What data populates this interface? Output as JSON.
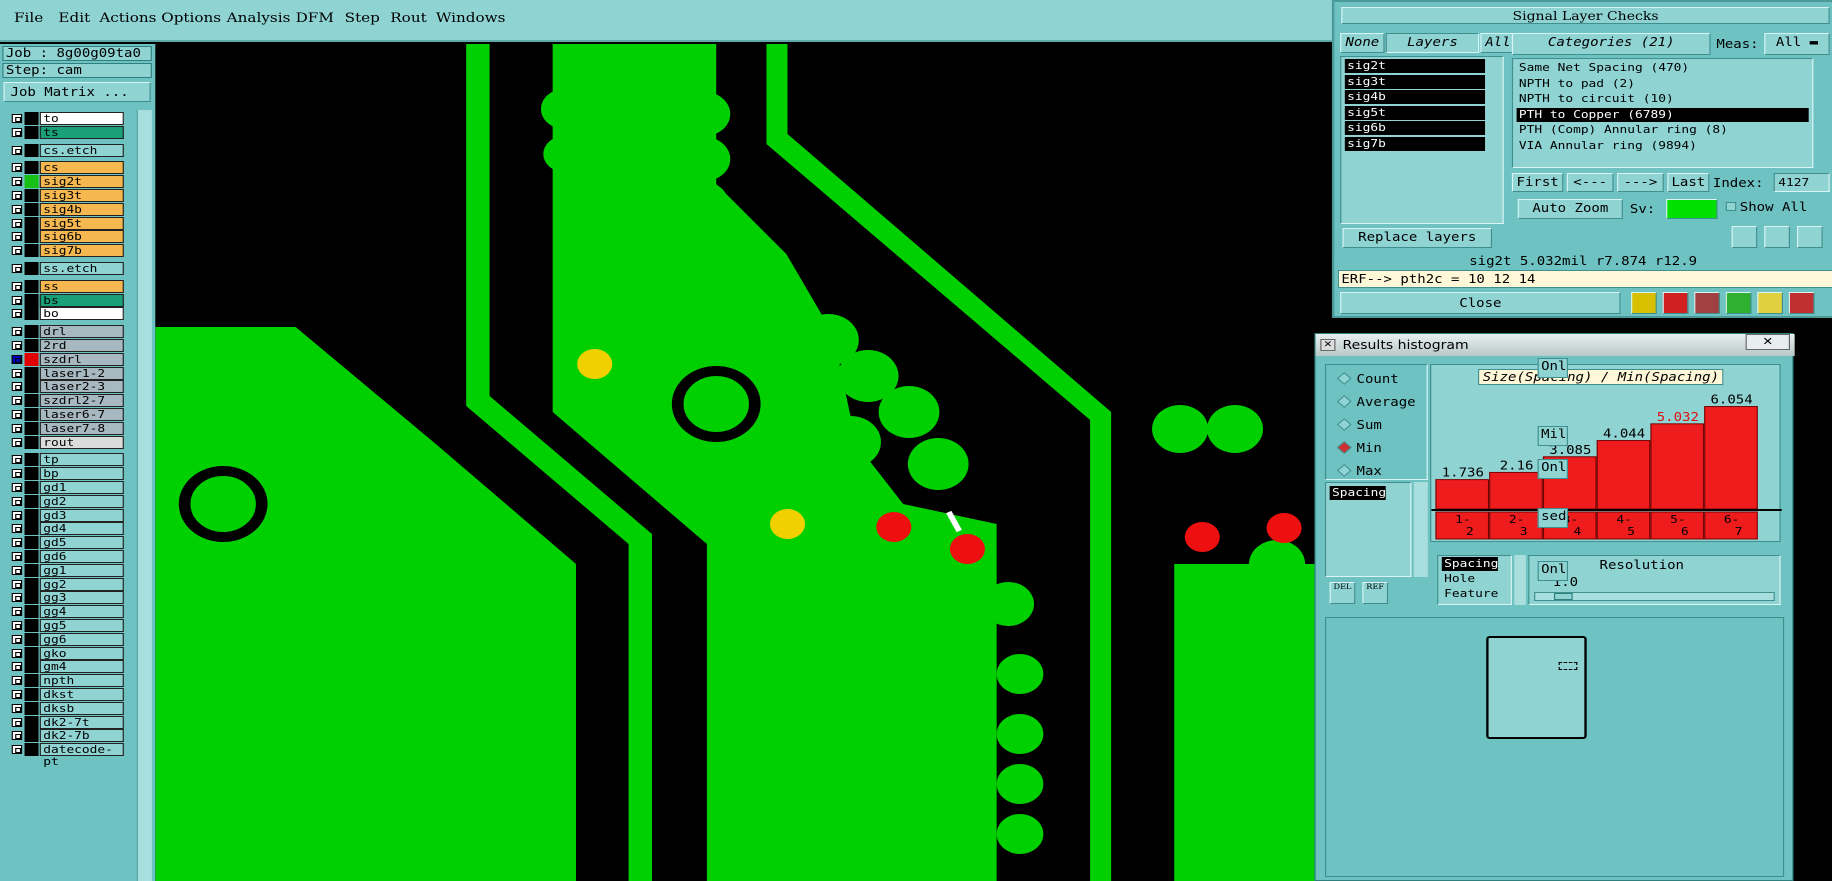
{
  "menu": [
    "File",
    "Edit",
    "Actions",
    "Options",
    "Analysis",
    "DFM",
    "Step",
    "Rout",
    "Windows"
  ],
  "job": {
    "label": "Job : 8g00g09ta0",
    "step": "Step: cam",
    "matrix_button": "Job Matrix ..."
  },
  "layers": [
    {
      "name": "to",
      "color": "#ffffff",
      "gap": false
    },
    {
      "name": "ts",
      "color": "#1aa078",
      "gap": false
    },
    {
      "name": "cs.etch",
      "color": "#8fd3d3",
      "gap": true
    },
    {
      "name": "cs",
      "color": "#f5b850",
      "gap": true
    },
    {
      "name": "sig2t",
      "color": "#f5b850",
      "gap": false,
      "swatch": "#16c016"
    },
    {
      "name": "sig3t",
      "color": "#f5b850",
      "gap": false
    },
    {
      "name": "sig4b",
      "color": "#f5b850",
      "gap": false
    },
    {
      "name": "sig5t",
      "color": "#f5b850",
      "gap": false
    },
    {
      "name": "sig6b",
      "color": "#f5b850",
      "gap": false
    },
    {
      "name": "sig7b",
      "color": "#f5b850",
      "gap": false
    },
    {
      "name": "ss.etch",
      "color": "#8fd3d3",
      "gap": true
    },
    {
      "name": "ss",
      "color": "#f5b850",
      "gap": true
    },
    {
      "name": "bs",
      "color": "#1aa078",
      "gap": false
    },
    {
      "name": "bo",
      "color": "#ffffff",
      "gap": false
    },
    {
      "name": "drl",
      "color": "#a8b8c0",
      "gap": true
    },
    {
      "name": "2rd",
      "color": "#a8b8c0",
      "gap": false
    },
    {
      "name": "szdrl",
      "color": "#a8b8c0",
      "gap": false,
      "swatch": "#e00000",
      "mark": "#0000c0"
    },
    {
      "name": "laser1-2",
      "color": "#a8b8c0",
      "gap": false
    },
    {
      "name": "laser2-3",
      "color": "#a8b8c0",
      "gap": false
    },
    {
      "name": "szdrl2-7",
      "color": "#a8b8c0",
      "gap": false
    },
    {
      "name": "laser6-7",
      "color": "#a8b8c0",
      "gap": false
    },
    {
      "name": "laser7-8",
      "color": "#a8b8c0",
      "gap": false
    },
    {
      "name": "rout",
      "color": "#dcdcdc",
      "gap": false
    },
    {
      "name": "tp",
      "color": "#8fd3d3",
      "gap": true
    },
    {
      "name": "bp",
      "color": "#8fd3d3",
      "gap": false
    },
    {
      "name": "gd1",
      "color": "#8fd3d3",
      "gap": false
    },
    {
      "name": "gd2",
      "color": "#8fd3d3",
      "gap": false
    },
    {
      "name": "gd3",
      "color": "#8fd3d3",
      "gap": false
    },
    {
      "name": "gd4",
      "color": "#8fd3d3",
      "gap": false
    },
    {
      "name": "gd5",
      "color": "#8fd3d3",
      "gap": false
    },
    {
      "name": "gd6",
      "color": "#8fd3d3",
      "gap": false
    },
    {
      "name": "gg1",
      "color": "#8fd3d3",
      "gap": false
    },
    {
      "name": "gg2",
      "color": "#8fd3d3",
      "gap": false
    },
    {
      "name": "gg3",
      "color": "#8fd3d3",
      "gap": false
    },
    {
      "name": "gg4",
      "color": "#8fd3d3",
      "gap": false
    },
    {
      "name": "gg5",
      "color": "#8fd3d3",
      "gap": false
    },
    {
      "name": "gg6",
      "color": "#8fd3d3",
      "gap": false
    },
    {
      "name": "gko",
      "color": "#8fd3d3",
      "gap": false
    },
    {
      "name": "gm4",
      "color": "#8fd3d3",
      "gap": false
    },
    {
      "name": "npth",
      "color": "#8fd3d3",
      "gap": false
    },
    {
      "name": "dkst",
      "color": "#8fd3d3",
      "gap": false
    },
    {
      "name": "dksb",
      "color": "#8fd3d3",
      "gap": false
    },
    {
      "name": "dk2-7t",
      "color": "#8fd3d3",
      "gap": false
    },
    {
      "name": "dk2-7b",
      "color": "#8fd3d3",
      "gap": false
    },
    {
      "name": "datecode-pt",
      "color": "#8fd3d3",
      "gap": false
    }
  ],
  "checks": {
    "title": "Signal Layer Checks",
    "none_button": "None",
    "layers_button": "Layers",
    "all_button": "All",
    "layer_list": [
      "sig2t",
      "sig3t",
      "sig4b",
      "sig5t",
      "sig6b",
      "sig7b"
    ],
    "categories_button": "Categories (21)",
    "meas_label": "Meas:",
    "meas_value": "All",
    "categories": [
      {
        "label": "Same Net Spacing (470)",
        "selected": false
      },
      {
        "label": "NPTH to pad (2)",
        "selected": false
      },
      {
        "label": "NPTH to circuit (10)",
        "selected": false
      },
      {
        "label": "PTH to Copper (6789)",
        "selected": true
      },
      {
        "label": "PTH (Comp) Annular ring (8)",
        "selected": false
      },
      {
        "label": "VIA Annular ring (9894)",
        "selected": false
      }
    ],
    "first_button": "First",
    "prev_button": "<---",
    "next_button": "--->",
    "last_button": "Last",
    "index_label": "Index:",
    "index_value": "4127",
    "autozoom_button": "Auto Zoom",
    "sv_label": "Sv:",
    "showall_label": "Show All",
    "replace_button": "Replace layers",
    "status_line": "sig2t 5.032mil  r7.874  r12.9",
    "erf_line": "ERF--> pth2c = 10 12 14",
    "close_button": "Close"
  },
  "histogram": {
    "window_title": "Results histogram",
    "radios": [
      {
        "label": "Count",
        "on": false
      },
      {
        "label": "Average",
        "on": false
      },
      {
        "label": "Sum",
        "on": false
      },
      {
        "label": "Min",
        "on": true
      },
      {
        "label": "Max",
        "on": false
      }
    ],
    "metric_list": [
      "Spacing"
    ],
    "selector_list": [
      "Spacing",
      "Hole",
      "Feature"
    ],
    "resolution_label": "Resolution",
    "resolution_value": "1.0",
    "del_button": "DEL",
    "ref_button": "REF"
  },
  "chart_data": {
    "type": "bar",
    "title": "Size(Spacing) / Min(Spacing)",
    "categories": [
      "1-2",
      "2-3",
      "3-4",
      "4-5",
      "5-6",
      "6-7"
    ],
    "values": [
      1.736,
      2.16,
      3.085,
      4.044,
      5.032,
      6.054
    ],
    "highlight_index": 4,
    "bar_color": "#ee1c1c",
    "highlight_label_color": "#e01010",
    "ylim": [
      0,
      6.5
    ]
  },
  "side_fragments": [
    "Onlin",
    "Mils",
    "Onlin",
    "sed",
    "Onlin"
  ],
  "colors": {
    "copper": "#00d000",
    "violation": "#ee1010",
    "marker": "#f0d000",
    "panel": "#8fd3d3"
  }
}
